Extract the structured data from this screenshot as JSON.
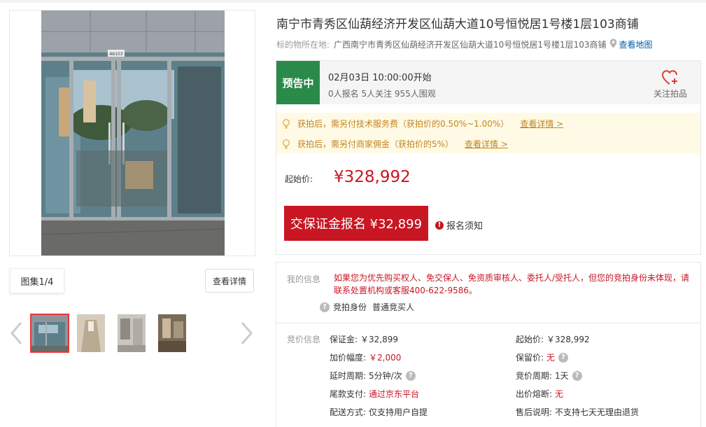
{
  "title": "南宁市青秀区仙葫经济开发区仙葫大道10号恒悦居1号楼1层103商铺",
  "address": {
    "label": "标的物所在地:",
    "value": "广西南宁市青秀区仙葫经济开发区仙葫大道10号恒悦居1号楼1层103商铺",
    "map_link": "查看地图",
    "icon": "map-pin-icon"
  },
  "gallery": {
    "album_label": "图集1/4",
    "detail_button": "查看详情",
    "photo_sign_text": "A6103"
  },
  "auction": {
    "status": "预告中",
    "start_time": "02月03日 10:00:00开始",
    "stats": "0人报名 5人关注 955人围观",
    "favorite_label": "关注拍品",
    "notices": [
      {
        "text": "获拍后，需另付技术服务费（获拍价的0.50%~1.00%）",
        "link": "查看详情 >"
      },
      {
        "text": "获拍后，需另付商家佣金（获拍价的5%）",
        "link": "查看详情 >"
      }
    ],
    "start_price_label": "起始价:",
    "start_price": "¥328,992",
    "signup_button": "交保证金报名 ¥32,899",
    "signup_notice": "报名须知"
  },
  "my_info": {
    "label": "我的信息",
    "message": "如果您为优先购买权人、免交保人、免资质审核人、委托人/受托人，但您的竞拍身份未体现，请联系处置机构或客服400-622-9586。",
    "identity_label": "竞拍身份",
    "identity_value": "普通竞买人"
  },
  "bid_info": {
    "label": "竞价信息",
    "deposit_label": "保证金:",
    "deposit": "￥32,899",
    "start_price_label": "起始价:",
    "start_price": "￥328,992",
    "increment_label": "加价幅度:",
    "increment": "￥2,000",
    "reserve_label": "保留价:",
    "reserve": "无",
    "delay_label": "延时周期:",
    "delay": "5分钟/次",
    "cycle_label": "竞价周期:",
    "cycle": "1天",
    "final_payment_label": "尾款支付:",
    "final_payment": "通过京东平台",
    "fuse_label": "出价熔断:",
    "fuse": "无",
    "delivery_label": "配送方式:",
    "delivery": "仅支持用户自提",
    "aftersale_label": "售后说明:",
    "aftersale": "不支持七天无理由退货"
  },
  "colors": {
    "accent_red": "#c81623",
    "status_green": "#2a8a4a",
    "notice_bg": "#fffae5",
    "notice_text": "#c28521",
    "link_blue": "#005ea7"
  }
}
